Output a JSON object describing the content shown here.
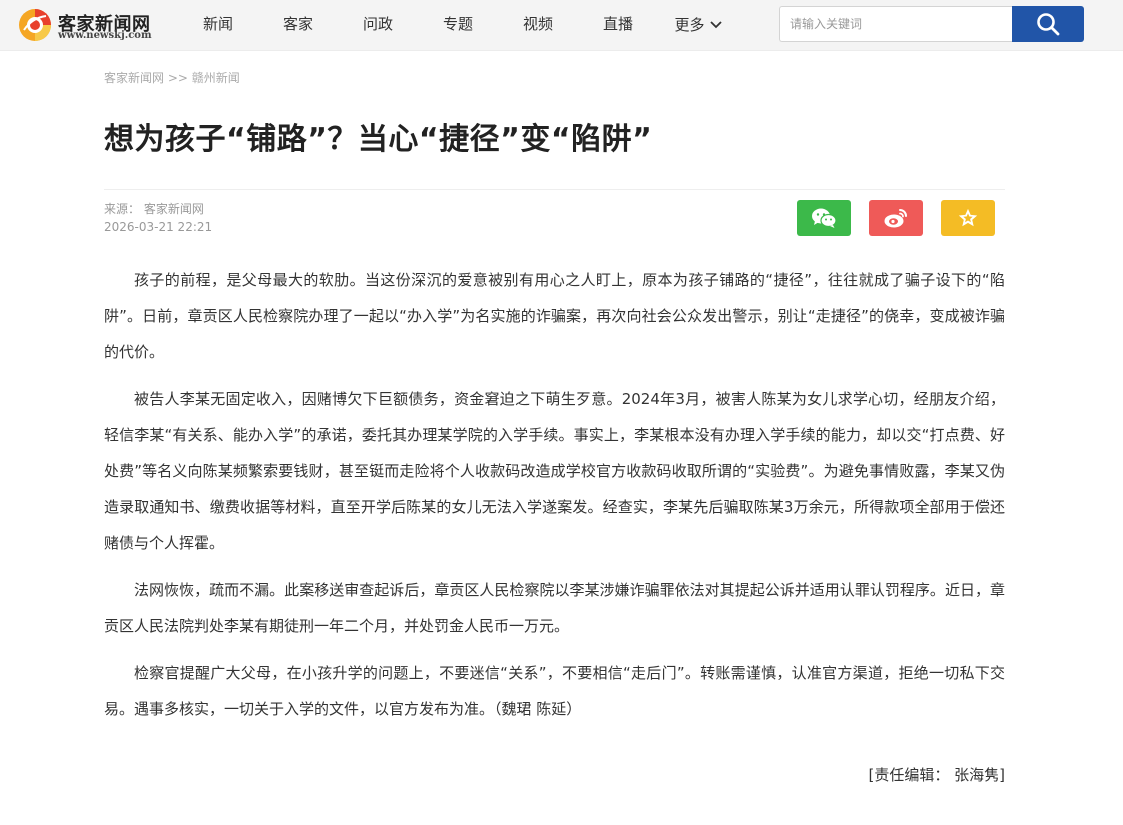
{
  "header": {
    "logo_name": "客家新闻网",
    "logo_url": "www.newskj.com",
    "nav": [
      "新闻",
      "客家",
      "问政",
      "专题",
      "视频",
      "直播"
    ],
    "nav_more": "更多",
    "search_placeholder": "请输入关键词"
  },
  "breadcrumb": {
    "home": "客家新闻网",
    "separator": ">>",
    "section": "赣州新闻"
  },
  "article": {
    "title": "想为孩子“铺路”？当心“捷径”变“陷阱”",
    "source_label": "来源：",
    "source": "客家新闻网",
    "datetime": "2026-03-21 22:21",
    "paragraphs": [
      "孩子的前程，是父母最大的软肋。当这份深沉的爱意被别有用心之人盯上，原本为孩子铺路的“捷径”，往往就成了骗子设下的“陷阱”。日前，章贡区人民检察院办理了一起以“办入学”为名实施的诈骗案，再次向社会公众发出警示，别让“走捷径”的侥幸，变成被诈骗的代价。",
      "被告人李某无固定收入，因赌博欠下巨额债务，资金窘迫之下萌生歹意。2024年3月，被害人陈某为女儿求学心切，经朋友介绍，轻信李某“有关系、能办入学”的承诺，委托其办理某学院的入学手续。事实上，李某根本没有办理入学手续的能力，却以交“打点费、好处费”等名义向陈某频繁索要钱财，甚至铤而走险将个人收款码改造成学校官方收款码收取所谓的“实验费”。为避免事情败露，李某又伪造录取通知书、缴费收据等材料，直至开学后陈某的女儿无法入学遂案发。经查实，李某先后骗取陈某3万余元，所得款项全部用于偿还赌债与个人挥霍。",
      "法网恢恢，疏而不漏。此案移送审查起诉后，章贡区人民检察院以李某涉嫌诈骗罪依法对其提起公诉并适用认罪认罚程序。近日，章贡区人民法院判处李某有期徒刑一年二个月，并处罚金人民币一万元。",
      "检察官提醒广大父母，在小孩升学的问题上，不要迷信“关系”，不要相信“走后门”。转账需谨慎，认准官方渠道，拒绝一切私下交易。遇事多核实，一切关于入学的文件，以官方发布为准。（魏珺 陈延）"
    ],
    "editor": "[责任编辑： 张海隽]"
  },
  "icons": {
    "search": "search-icon",
    "wechat": "wechat-icon",
    "weibo": "weibo-icon",
    "favorite": "star-icon",
    "more": "chevron-down-icon"
  },
  "colors": {
    "search_button": "#2155a8",
    "wechat": "#3cb94a",
    "weibo": "#ef5a58",
    "favorite": "#f4bc25"
  }
}
